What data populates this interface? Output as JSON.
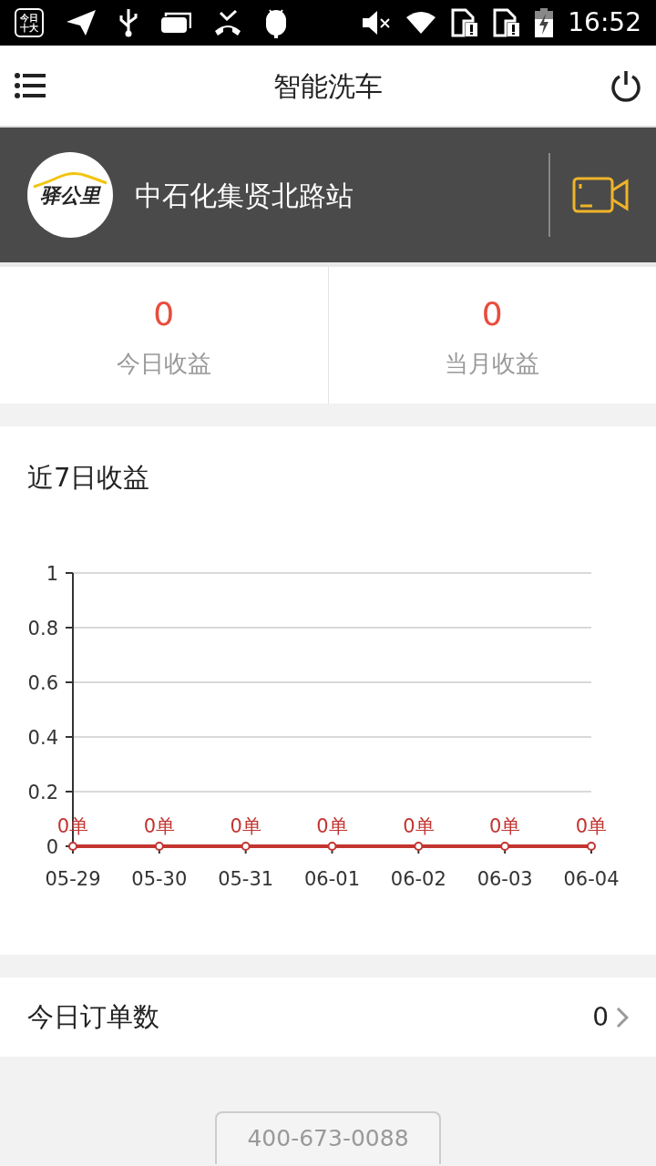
{
  "status_bar": {
    "app_badge": "今日十大",
    "time": "16:52"
  },
  "app_bar": {
    "title": "智能洗车"
  },
  "station": {
    "logo_text": "驿公里",
    "name": "中石化集贤北路站"
  },
  "stats": [
    {
      "value": "0",
      "label": "今日收益"
    },
    {
      "value": "0",
      "label": "当月收益"
    }
  ],
  "chart_card": {
    "title": "近7日收益",
    "chart_data": {
      "type": "line",
      "categories": [
        "05-29",
        "05-30",
        "05-31",
        "06-01",
        "06-02",
        "06-03",
        "06-04"
      ],
      "series": [
        {
          "color": "#c23531",
          "marker": true,
          "values": [
            0,
            0,
            0,
            0,
            0,
            0,
            0
          ]
        }
      ],
      "grid": true,
      "ylim": [
        0,
        1
      ],
      "yticks": [
        0,
        {
          "value": 0.2,
          "label": "0.2"
        },
        {
          "value": 0.4,
          "label": "0.4"
        },
        {
          "value": 0.6,
          "label": "0.6"
        },
        {
          "value": 0.8,
          "label": "0.8"
        },
        1
      ],
      "value_labels": [
        "0单",
        "0单",
        "0单",
        "0单",
        "0单",
        "0单",
        "0单"
      ]
    }
  },
  "orders": {
    "label": "今日订单数",
    "value": "0"
  },
  "hotline": "400-673-0088"
}
